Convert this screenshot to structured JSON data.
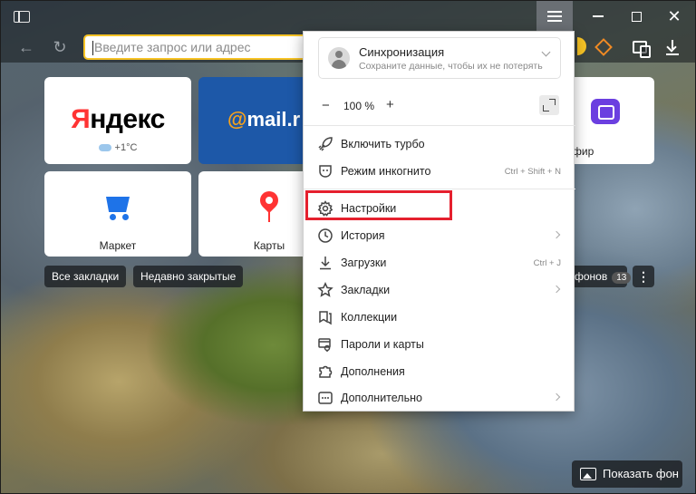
{
  "titlebar": {
    "icons": [
      "sidebar-toggle-icon",
      "menu-icon",
      "minimize-icon",
      "maximize-icon",
      "close-icon"
    ]
  },
  "navbar": {
    "address_placeholder": "Введите запрос или адрес",
    "icons": [
      "back-arrow-icon",
      "reload-icon",
      "alice-icon",
      "collections-icon",
      "download-icon"
    ]
  },
  "tiles": {
    "yandex": {
      "logo_first": "Я",
      "logo_rest": "ндекс",
      "weather": "+1°C"
    },
    "mail": {
      "logo_at": "@",
      "logo_text": "mail.r"
    },
    "market": {
      "label": "Маркет"
    },
    "maps": {
      "label": "Карты"
    },
    "efir": {
      "label": "фир"
    }
  },
  "chips": {
    "all_bookmarks": "Все закладки",
    "recently_closed": "Недавно закрытые",
    "backgrounds": "фонов",
    "backgrounds_count": "13",
    "more": "⋮"
  },
  "show_background": "Показать фон",
  "menu": {
    "sync": {
      "title": "Синхронизация",
      "subtitle": "Сохраните данные, чтобы их не потерять"
    },
    "zoom": {
      "minus": "−",
      "value": "100 %",
      "plus": "+"
    },
    "items": [
      {
        "label": "Включить турбо",
        "icon": "rocket-icon",
        "shortcut": ""
      },
      {
        "label": "Режим инкогнито",
        "icon": "incognito-icon",
        "shortcut": "Ctrl + Shift + N"
      },
      {
        "label": "Настройки",
        "icon": "gear-icon",
        "shortcut": ""
      },
      {
        "label": "История",
        "icon": "clock-icon",
        "shortcut": ""
      },
      {
        "label": "Загрузки",
        "icon": "download-icon",
        "shortcut": "Ctrl + J"
      },
      {
        "label": "Закладки",
        "icon": "star-icon",
        "shortcut": ""
      },
      {
        "label": "Коллекции",
        "icon": "collections-icon",
        "shortcut": ""
      },
      {
        "label": "Пароли и карты",
        "icon": "key-card-icon",
        "shortcut": ""
      },
      {
        "label": "Дополнения",
        "icon": "puzzle-icon",
        "shortcut": ""
      },
      {
        "label": "Дополнительно",
        "icon": "more-dots-icon",
        "shortcut": ""
      }
    ]
  },
  "colors": {
    "accent": "#f7c325",
    "highlight": "#e5202e",
    "mail_bg": "#1d58a8",
    "market_blue": "#1e73e8",
    "efir_purple": "#6b3fe0"
  }
}
